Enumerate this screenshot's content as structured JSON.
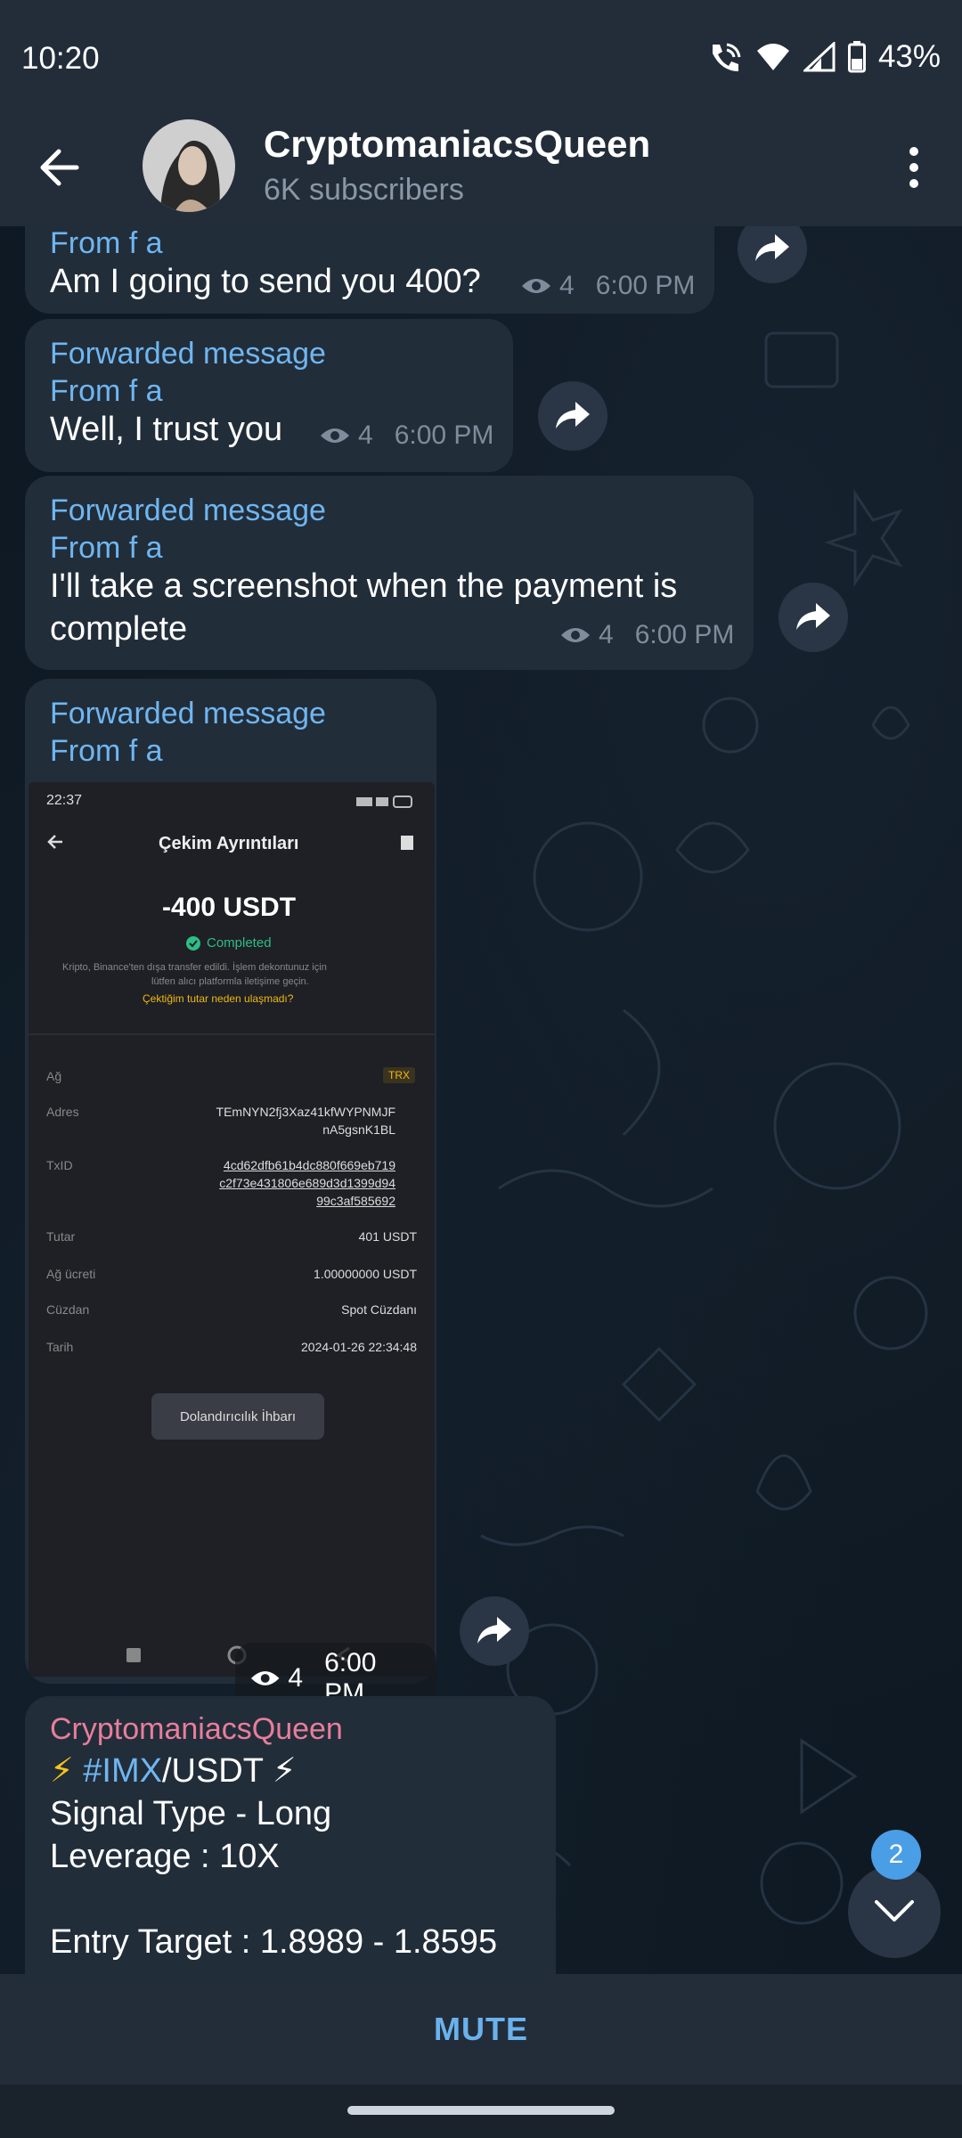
{
  "status_bar": {
    "time": "10:20",
    "battery": "43%"
  },
  "header": {
    "title": "CryptomaniacsQueen",
    "subtitle": "6K subscribers"
  },
  "messages": [
    {
      "forwarded_label": "",
      "from": "From f a",
      "text": "Am I going to send you 400?",
      "views": "4",
      "time": "6:00 PM"
    },
    {
      "forwarded_label": "Forwarded message",
      "from": "From f a",
      "text": "Well, I trust you",
      "views": "4",
      "time": "6:00 PM"
    },
    {
      "forwarded_label": "Forwarded message",
      "from": "From f a",
      "text_line1": "I'll take a screenshot when the payment is",
      "text_line2": "complete",
      "views": "4",
      "time": "6:00 PM"
    },
    {
      "forwarded_label": "Forwarded message",
      "from": "From f a",
      "views": "4",
      "time": "6:00 PM"
    }
  ],
  "screenshot": {
    "time": "22:37",
    "title": "Çekim Ayrıntıları",
    "amount": "-400 USDT",
    "status": "Completed",
    "note_line1": "Kripto, Binance'ten dışa transfer edildi. İşlem dekontunuz için",
    "note_line2": "lütfen alıcı platformla iletişime geçin.",
    "link": "Çektiğim tutar neden ulaşmadı?",
    "rows": [
      {
        "label": "Ağ",
        "value": "TRX"
      },
      {
        "label": "Adres",
        "value": "TEmNYN2fj3Xaz41kfWYPNMJF",
        "value2": "nA5gsnK1BL"
      },
      {
        "label": "TxID",
        "value": "4cd62dfb61b4dc880f669eb719",
        "value2": "c2f73e431806e689d3d1399d94",
        "value3": "99c3af585692"
      },
      {
        "label": "Tutar",
        "value": "401 USDT"
      },
      {
        "label": "Ağ ücreti",
        "value": "1.00000000 USDT"
      },
      {
        "label": "Cüzdan",
        "value": "Spot Cüzdanı"
      },
      {
        "label": "Tarih",
        "value": "2024-01-26 22:34:48"
      }
    ],
    "button": "Dolandırıcılık İhbarı"
  },
  "signal_post": {
    "author": "CryptomaniacsQueen",
    "line1_prefix": "⚡ ",
    "line1_tag": "#IMX",
    "line1_suffix": "/USDT ⚡",
    "line2": "Signal Type - Long",
    "line3": "Leverage : 10X",
    "line4": "Entry Target : 1.8989 - 1.8595"
  },
  "scroll": {
    "unread_count": "2"
  },
  "footer": {
    "mute_label": "MUTE"
  },
  "colors": {
    "accent": "#6fb6f0",
    "author": "#e87e9a",
    "bubble": "#222d3a",
    "header": "#232d3a"
  }
}
